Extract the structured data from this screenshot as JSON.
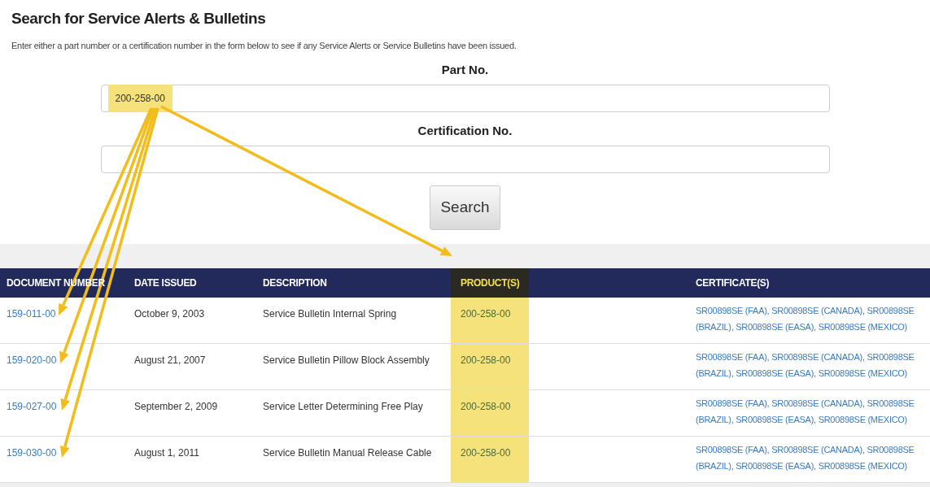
{
  "page": {
    "title": "Search for Service Alerts & Bulletins",
    "intro": "Enter either a part number or a certification number in the form below to see if any Service Alerts or Service Bulletins have been issued."
  },
  "form": {
    "fields": [
      {
        "label": "Part No.",
        "value": "200-258-00",
        "highlighted": true
      },
      {
        "label": "Certification No."
      }
    ],
    "button": "Search"
  },
  "table": {
    "columns": [
      {
        "label": "DOCUMENT NUMBER",
        "highlighted": false
      },
      {
        "label": "DATE ISSUED",
        "highlighted": false
      },
      {
        "label": "DESCRIPTION",
        "highlighted": false
      },
      {
        "label": "PRODUCT(S)",
        "highlighted": true
      },
      {
        "label": "CERTIFICATE(S)",
        "highlighted": false
      }
    ],
    "rows": [
      {
        "document": "159-011-00",
        "date": "October 9, 2003",
        "description": "Service Bulletin Internal Spring",
        "product": "200-258-00",
        "certificates": "SR00898SE (FAA), SR00898SE (CANADA), SR00898SE (BRAZIL), SR00898SE (EASA), SR00898SE (MEXICO)"
      },
      {
        "document": "159-020-00",
        "date": "August 21, 2007",
        "description": "Service Bulletin Pillow Block Assembly",
        "product": "200-258-00",
        "certificates": "SR00898SE (FAA), SR00898SE (CANADA), SR00898SE (BRAZIL), SR00898SE (EASA), SR00898SE (MEXICO)"
      },
      {
        "document": "159-027-00",
        "date": "September 2, 2009",
        "description": "Service Letter Determining Free Play",
        "product": "200-258-00",
        "certificates": "SR00898SE (FAA), SR00898SE (CANADA), SR00898SE (BRAZIL), SR00898SE (EASA), SR00898SE (MEXICO)"
      },
      {
        "document": "159-030-00",
        "date": "August 1, 2011",
        "description": "Service Bulletin Manual Release Cable",
        "product": "200-258-00",
        "certificates": "SR00898SE (FAA), SR00898SE (CANADA), SR00898SE (BRAZIL), SR00898SE (EASA), SR00898SE (MEXICO)"
      }
    ]
  }
}
